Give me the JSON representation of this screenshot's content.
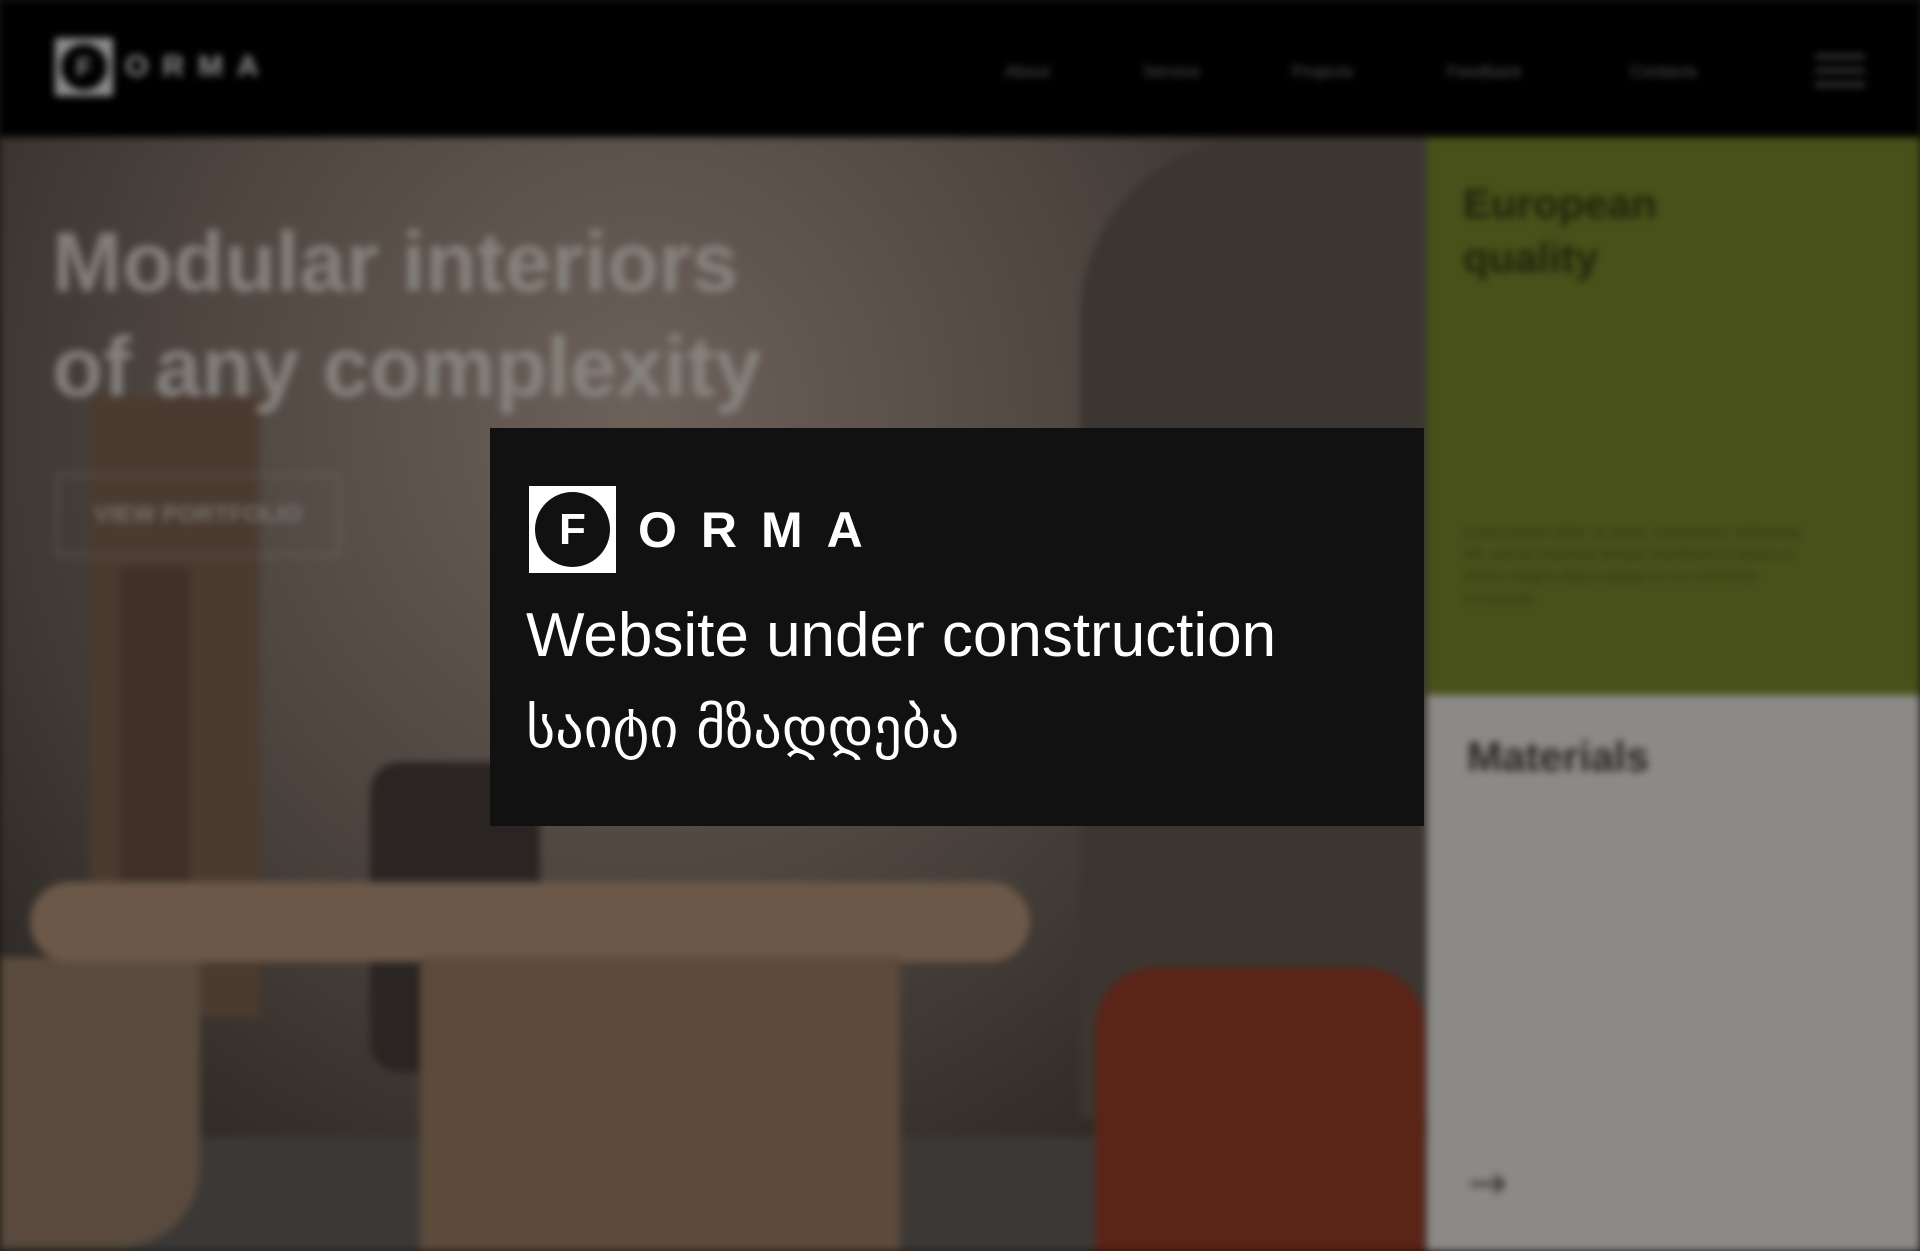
{
  "header": {
    "logo_letter": "F",
    "logo_text": "ORMA",
    "nav": [
      "About",
      "Service",
      "Projects",
      "Feedback",
      "Contacts"
    ]
  },
  "hero": {
    "title_line1": "Modular interiors",
    "title_line2": "of any complexity",
    "button_label": "VIEW PORTFOLIO"
  },
  "panels": {
    "green_title_line1": "European",
    "green_title_line2": "quality",
    "green_text": "Lorem ipsum dolor sit amet, consectetur adipiscing elit, sed do eiusmod tempor incididunt ut labore et dolore magna aliqua aliquip ex ea commodo consequat.",
    "gray_title": "Materials",
    "arrow_icon": "arrow-right-icon"
  },
  "modal": {
    "logo_letter": "F",
    "logo_text": "ORMA",
    "message_en": "Website under construction",
    "message_ka": "საიტი მზადდება"
  },
  "colors": {
    "modal_bg": "#111111",
    "green_panel": "#48511a",
    "header_bg": "#000000"
  }
}
